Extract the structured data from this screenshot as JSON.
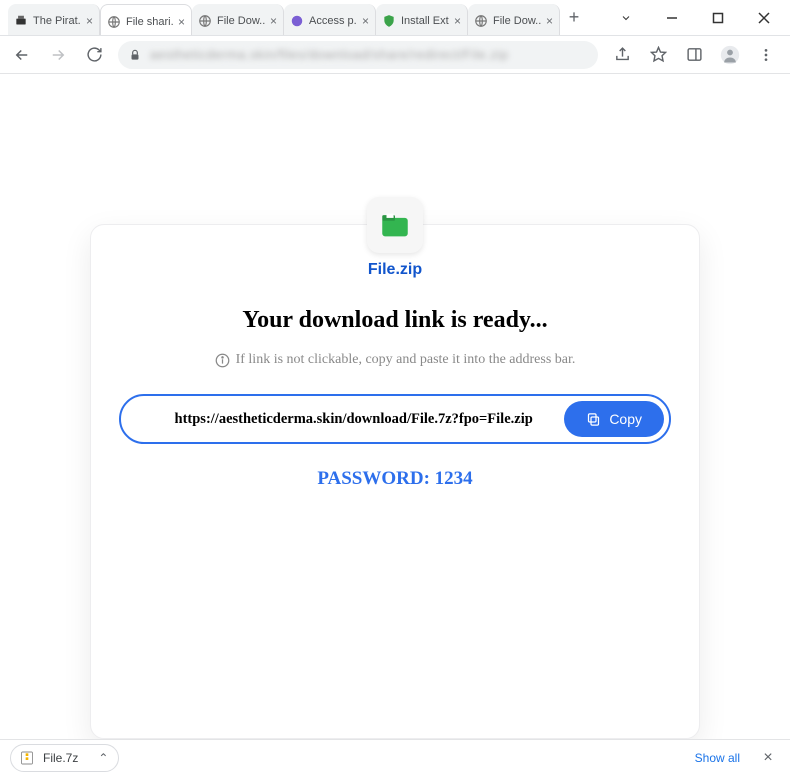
{
  "tabs": [
    {
      "label": "The Pirat...",
      "icon": "printer"
    },
    {
      "label": "File shari...",
      "icon": "globe",
      "active": true
    },
    {
      "label": "File Dow...",
      "icon": "globe"
    },
    {
      "label": "Access p...",
      "icon": "purple"
    },
    {
      "label": "Install Ext...",
      "icon": "shield"
    },
    {
      "label": "File Dow...",
      "icon": "globe"
    }
  ],
  "card": {
    "filename": "File.zip",
    "heading": "Your download link is ready...",
    "hint": "If link is not clickable, copy and paste it into the address bar.",
    "url": "https://aestheticderma.skin/download/File.7z?fpo=File.zip",
    "copy_label": "Copy",
    "password_label": "PASSWORD: 1234"
  },
  "download": {
    "filename": "File.7z",
    "showall": "Show all"
  }
}
